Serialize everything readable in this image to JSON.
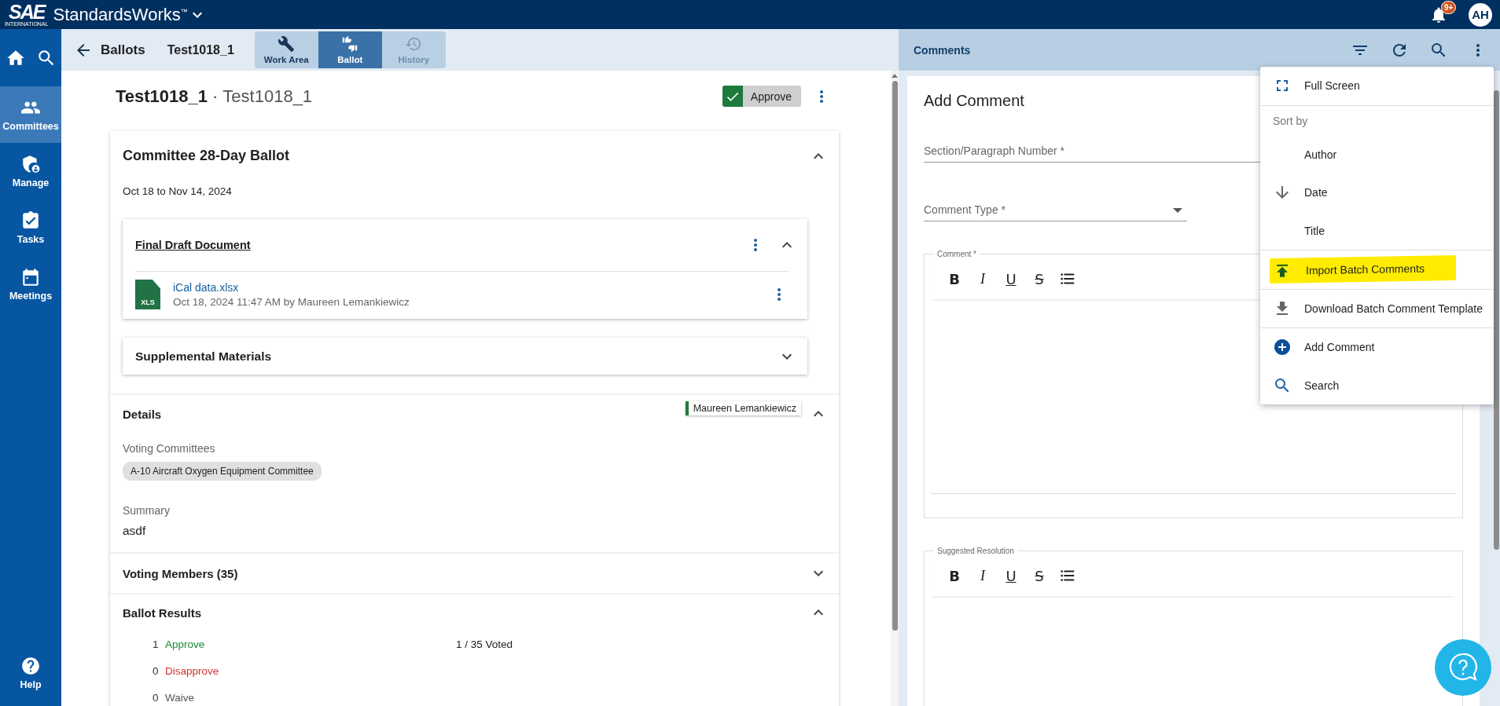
{
  "app_bar": {
    "logo_mark": "SAE",
    "logo_sub": "INTERNATIONAL",
    "product": "StandardsWorks$^{™}$",
    "notification_count": "9+",
    "avatar_initials": "AH"
  },
  "rail": {
    "items": [
      {
        "kind": "committees",
        "label": "Committees",
        "selected": true
      },
      {
        "kind": "manage",
        "label": "Manage",
        "selected": false
      },
      {
        "kind": "tasks",
        "label": "Tasks",
        "selected": false
      },
      {
        "kind": "meetings",
        "label": "Meetings",
        "selected": false
      }
    ],
    "help": "Help"
  },
  "subbar": {
    "back_label": "Ballots",
    "document": "Test1018_1",
    "tabs": [
      {
        "kind": "work_area",
        "label": "Work Area",
        "selected": false,
        "disabled": false
      },
      {
        "kind": "ballot",
        "label": "Ballot",
        "selected": true,
        "disabled": false
      },
      {
        "kind": "history",
        "label": "History",
        "selected": false,
        "disabled": true
      }
    ]
  },
  "ballot": {
    "title": "Test1018_1",
    "separator": "·",
    "subtitle": "Test1018_1",
    "vote": {
      "kind": "approve",
      "label": "Approve"
    },
    "card": {
      "title": "Committee 28-Day Ballot",
      "expanded": true,
      "dates": "Oct 18 to Nov 14, 2024",
      "documents": [
        {
          "title": "Final Draft Document",
          "expanded": true,
          "files": [
            {
              "type_label": "XLS",
              "name": "iCal data.xlsx",
              "meta": "Oct 18, 2024 11:47 AM by Maureen Lemankiewicz"
            }
          ]
        },
        {
          "title": "Supplemental Materials",
          "expanded": false
        }
      ],
      "details": {
        "title": "Details",
        "expanded": true,
        "author_tag": "Maureen Lemankiewicz",
        "committees_label": "Voting Committees",
        "committees": [
          "A-10 Aircraft Oxygen Equipment Committee"
        ],
        "summary_label": "Summary",
        "summary": "asdf"
      },
      "voting_members": {
        "title": "Voting Members (35)",
        "expanded": false
      },
      "results": {
        "title": "Ballot Results",
        "expanded": true,
        "tally": "1 / 35 Voted",
        "rows": [
          {
            "kind": "approve",
            "count": "1",
            "label": "Approve"
          },
          {
            "kind": "disapprove",
            "count": "0",
            "label": "Disapprove"
          },
          {
            "kind": "waive",
            "count": "0",
            "label": "Waive"
          }
        ]
      }
    }
  },
  "comments": {
    "title": "Comments",
    "form": {
      "title": "Add Comment",
      "section_placeholder": "Section/Paragraph Number *",
      "type_placeholder": "Comment Type *",
      "editors": [
        {
          "label": "Comment *",
          "tools": [
            {
              "kind": "bold",
              "glyph": "B"
            },
            {
              "kind": "italic",
              "glyph": "I"
            },
            {
              "kind": "underline",
              "glyph": "U"
            },
            {
              "kind": "strike",
              "glyph": "S"
            },
            {
              "kind": "list"
            }
          ]
        },
        {
          "label": "Suggested Resolution",
          "tools": [
            {
              "kind": "bold",
              "glyph": "B"
            },
            {
              "kind": "italic",
              "glyph": "I"
            },
            {
              "kind": "underline",
              "glyph": "U"
            },
            {
              "kind": "strike",
              "glyph": "S"
            },
            {
              "kind": "list"
            }
          ]
        }
      ]
    },
    "menu": {
      "items": [
        {
          "kind": "fullscreen",
          "label": "Full Screen",
          "highlighted": false
        },
        {
          "kind": "heading",
          "label": "Sort by"
        },
        {
          "kind": "sort",
          "label": "Author",
          "selected": false
        },
        {
          "kind": "sort",
          "label": "Date",
          "selected": true
        },
        {
          "kind": "sort",
          "label": "Title",
          "selected": false
        },
        {
          "kind": "import",
          "label": "Import Batch Comments",
          "highlighted": true
        },
        {
          "kind": "download",
          "label": "Download Batch Comment Template",
          "highlighted": false
        },
        {
          "kind": "add",
          "label": "Add Comment",
          "highlighted": false
        },
        {
          "kind": "search",
          "label": "Search",
          "highlighted": false
        }
      ]
    }
  }
}
